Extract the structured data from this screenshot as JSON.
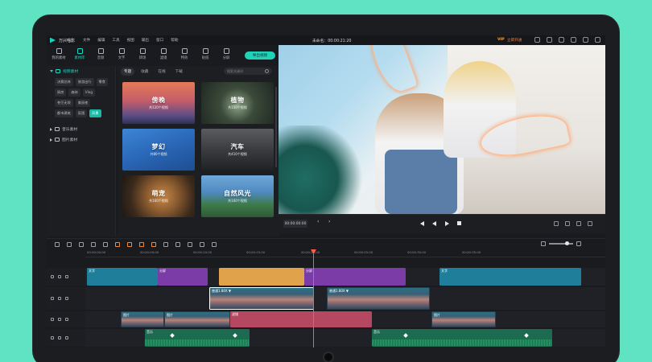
{
  "app": {
    "name": "万兴喵影",
    "project_title": "未命名：00:00:21:20",
    "vip": "VIP",
    "vip_action": "立即开通"
  },
  "menu": [
    "文件",
    "编辑",
    "工具",
    "视图",
    "输出",
    "窗口",
    "帮助"
  ],
  "toolbar": {
    "items": [
      {
        "label": "我的素材",
        "icon": "my-media-icon"
      },
      {
        "label": "素材库",
        "icon": "library-folder-icon"
      },
      {
        "label": "音频",
        "icon": "music-icon"
      },
      {
        "label": "文字",
        "icon": "text-icon"
      },
      {
        "label": "转场",
        "icon": "transition-icon"
      },
      {
        "label": "滤镜",
        "icon": "filter-icon"
      },
      {
        "label": "特效",
        "icon": "effects-icon"
      },
      {
        "label": "贴纸",
        "icon": "sticker-icon"
      },
      {
        "label": "分屏",
        "icon": "split-screen-icon"
      }
    ],
    "export_label": "导出视频"
  },
  "sidebar": {
    "section_video": "视频素材",
    "tags": [
      "决赛总林",
      "旅游出行",
      "零食",
      "厨房",
      "森林",
      "Vlog",
      "苍茫无垠",
      "美丽夜",
      "都市建筑",
      "氛围",
      "风景"
    ],
    "active_tag": "氛围",
    "section_music": "音乐素材",
    "section_image": "图片素材"
  },
  "media": {
    "tabs": [
      "专题",
      "收藏",
      "在线",
      "下载"
    ],
    "active_tab": "专题",
    "search_placeholder": "搜索关键词",
    "cards": [
      {
        "title": "傍晚",
        "subtitle": "共120个视频"
      },
      {
        "title": "植物",
        "subtitle": "共150个视频"
      },
      {
        "title": "梦幻",
        "subtitle": "共80个视频"
      },
      {
        "title": "汽车",
        "subtitle": "共410个视频"
      },
      {
        "title": "萌宠",
        "subtitle": "共160个视频"
      },
      {
        "title": "自然风光",
        "subtitle": "共100个视频"
      }
    ]
  },
  "playback": {
    "timecode": "00:00:00:00"
  },
  "timeline": {
    "ruler": [
      "00:00:00:00",
      "00:00:05:00",
      "00:00:10:00",
      "00:00:15:00",
      "00:00:20:00",
      "00:00:25:00",
      "00:00:30:00",
      "00:00:35:00"
    ],
    "clips": {
      "text1": "文字",
      "split1": "分屏",
      "split2": "分屏",
      "text2": "文字",
      "speed1": "普通1.80X ▼",
      "speed2": "普通1.80X ▼",
      "video_a": "图片",
      "video_b": "图片",
      "video_c": "滤镜",
      "video_d": "图片",
      "audio1": "音乐",
      "audio2": "音乐"
    }
  },
  "colors": {
    "accent": "#19d6c1",
    "background": "#5fe3c3",
    "playhead": "#ff5a4a"
  }
}
